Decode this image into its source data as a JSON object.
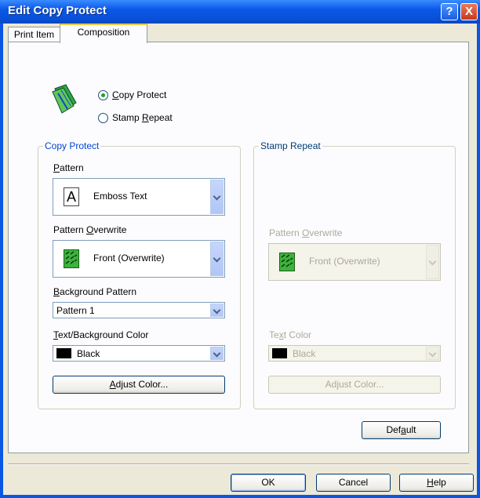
{
  "window": {
    "title": "Edit Copy Protect",
    "help_button": "?",
    "close_button": "X"
  },
  "tabs": [
    {
      "label": "Print Item",
      "active": false
    },
    {
      "label": "Composition",
      "active": true
    }
  ],
  "mode": {
    "options": [
      {
        "label_u": "C",
        "label_rest": "opy Protect",
        "selected": true
      },
      {
        "label_pre": "Stamp ",
        "label_u": "R",
        "label_rest": "epeat",
        "selected": false
      }
    ]
  },
  "copy_protect": {
    "legend": "Copy Protect",
    "pattern_label_u": "P",
    "pattern_label_rest": "attern",
    "pattern_value": "Emboss Text",
    "pattern_icon": "A",
    "overwrite_label_pre": "Pattern ",
    "overwrite_label_u": "O",
    "overwrite_label_rest": "verwrite",
    "overwrite_value": "Front (Overwrite)",
    "bg_label_u": "B",
    "bg_label_rest": "ackground Pattern",
    "bg_value": "Pattern 1",
    "color_label_u": "T",
    "color_label_rest": "ext/Background Color",
    "color_value": "Black",
    "swatch_color": "#000000",
    "adjust_label_u": "A",
    "adjust_label_rest": "djust Color..."
  },
  "stamp_repeat": {
    "legend": "Stamp Repeat",
    "overwrite_label_pre": "Pattern ",
    "overwrite_label_u": "O",
    "overwrite_label_rest": "verwrite",
    "overwrite_value": "Front (Overwrite)",
    "color_label_pre": "Te",
    "color_label_u": "x",
    "color_label_rest": "t Color",
    "color_value": "Black",
    "adjust_label": "Adjust Color..."
  },
  "buttons": {
    "default_pre": "Def",
    "default_u": "a",
    "default_rest": "ult",
    "ok": "OK",
    "cancel": "Cancel",
    "help_u": "H",
    "help_rest": "elp"
  },
  "colors": {
    "titlebar": "#0a58e8",
    "accent_green": "#21a121",
    "disabled_text": "#aca899"
  }
}
